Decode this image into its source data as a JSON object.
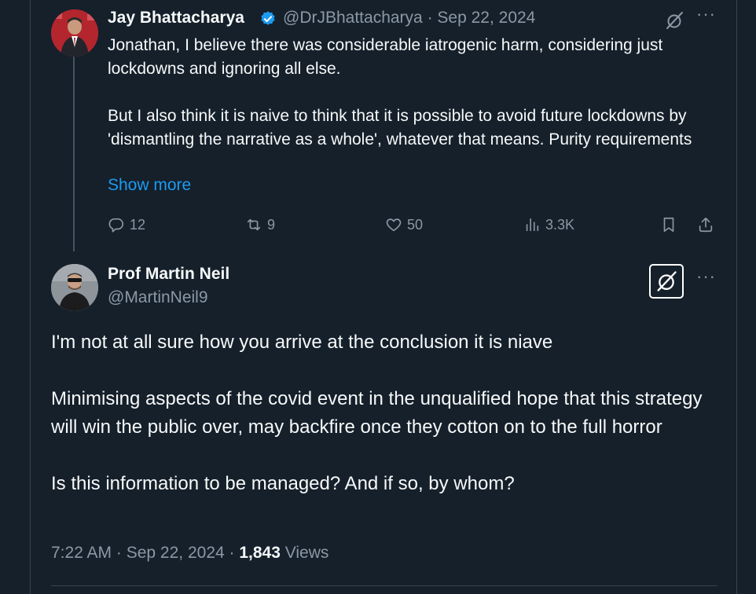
{
  "parent_tweet": {
    "author_name": "Jay Bhattacharya",
    "handle": "@DrJBhattacharya",
    "separator": "·",
    "date": "Sep 22, 2024",
    "text_lines": [
      "Jonathan, I believe there was considerable iatrogenic harm, considering just lockdowns and ignoring all else.",
      "But I also think it is naive to think that it is possible to avoid future lockdowns by 'dismantling the narrative as a whole', whatever that means. Purity requirements"
    ],
    "show_more": "Show more",
    "metrics": {
      "replies": "12",
      "retweets": "9",
      "likes": "50",
      "views": "3.3K"
    },
    "icons": {
      "verified": "verified-badge-icon",
      "grok": "grok-icon",
      "more": "more-icon"
    },
    "colors": {
      "accent": "#1d9bf0",
      "background": "#15202b",
      "muted": "#8b98a5"
    }
  },
  "main_tweet": {
    "author_name": "Prof Martin Neil",
    "handle": "@MartinNeil9",
    "paragraphs": [
      "I'm not at all sure how you arrive at the conclusion it is niave",
      "Minimising aspects of the covid event in the unqualified hope that this strategy will win the public over, may backfire once they cotton on to the full horror",
      "Is this information to be managed? And if so, by whom?"
    ],
    "time": "7:22 AM",
    "sep1": " · ",
    "date": "Sep 22, 2024",
    "sep2": " · ",
    "views_count": "1,843",
    "views_label": " Views",
    "more_glyph": "···"
  }
}
